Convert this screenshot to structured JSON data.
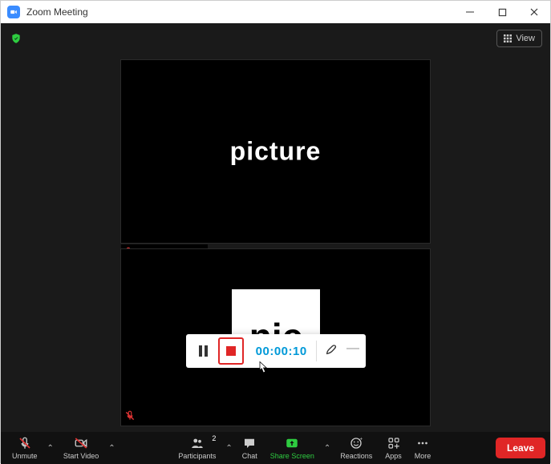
{
  "window": {
    "title": "Zoom Meeting"
  },
  "topbar": {
    "view_label": "View"
  },
  "tiles": {
    "main_label": "picture",
    "preview_text": "nic"
  },
  "recording_bar": {
    "timer": "00:00:10"
  },
  "toolbar": {
    "unmute": "Unmute",
    "start_video": "Start Video",
    "participants": "Participants",
    "participants_count": "2",
    "chat": "Chat",
    "share_screen": "Share Screen",
    "reactions": "Reactions",
    "apps": "Apps",
    "more": "More",
    "leave": "Leave"
  }
}
